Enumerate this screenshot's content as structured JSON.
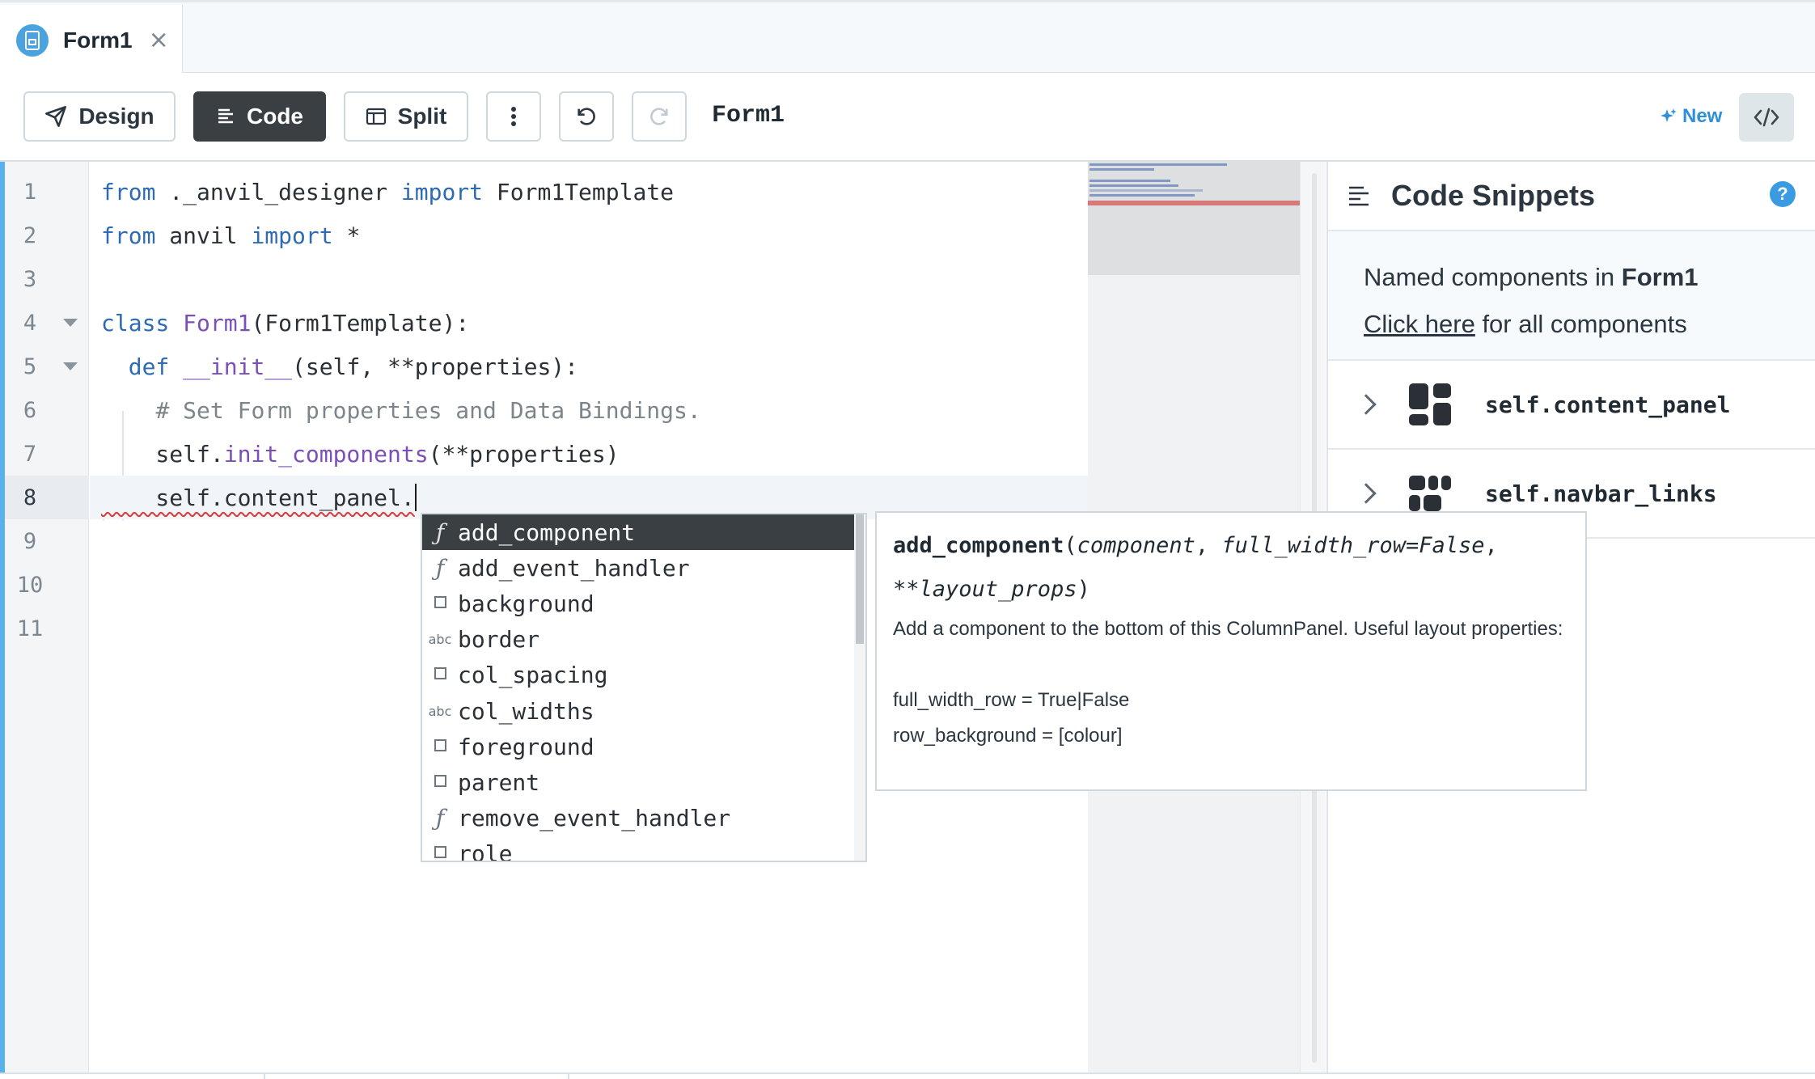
{
  "tab": {
    "label": "Form1",
    "close": "×"
  },
  "toolbar": {
    "design_label": "Design",
    "code_label": "Code",
    "split_label": "Split",
    "form_title": "Form1",
    "new_label": "New"
  },
  "editor": {
    "line_numbers": [
      "1",
      "2",
      "3",
      "4",
      "5",
      "6",
      "7",
      "8",
      "9",
      "10",
      "11"
    ],
    "current_line": 8,
    "lines": [
      [
        {
          "t": "from",
          "c": "kw"
        },
        {
          "t": " ._anvil_designer ",
          "c": "plain"
        },
        {
          "t": "import",
          "c": "kw"
        },
        {
          "t": " Form1Template",
          "c": "plain"
        }
      ],
      [
        {
          "t": "from",
          "c": "kw"
        },
        {
          "t": " anvil ",
          "c": "plain"
        },
        {
          "t": "import",
          "c": "kw"
        },
        {
          "t": " *",
          "c": "plain"
        }
      ],
      [],
      [
        {
          "t": "class",
          "c": "kw"
        },
        {
          "t": " ",
          "c": "plain"
        },
        {
          "t": "Form1",
          "c": "fn"
        },
        {
          "t": "(Form1Template):",
          "c": "plain"
        }
      ],
      [
        {
          "t": "  ",
          "c": "plain"
        },
        {
          "t": "def",
          "c": "kw"
        },
        {
          "t": " ",
          "c": "plain"
        },
        {
          "t": "__init__",
          "c": "fn"
        },
        {
          "t": "(self, **properties):",
          "c": "plain"
        }
      ],
      [
        {
          "t": "    ",
          "c": "plain"
        },
        {
          "t": "# Set Form properties and Data Bindings.",
          "c": "cm"
        }
      ],
      [
        {
          "t": "    self.",
          "c": "plain"
        },
        {
          "t": "init_components",
          "c": "fn"
        },
        {
          "t": "(**properties)",
          "c": "plain"
        }
      ],
      [
        {
          "t": "    self.content_panel.",
          "c": "plain"
        }
      ],
      [],
      [],
      []
    ]
  },
  "snippets": {
    "title": "Code Snippets",
    "help": "?",
    "named_prefix": "Named components in ",
    "form_name": "Form1",
    "click_here": "Click here",
    "all_components": " for all components",
    "components": [
      "self.content_panel",
      "self.navbar_links"
    ]
  },
  "autocomplete": {
    "items": [
      {
        "kind": "fn",
        "name": "add_component"
      },
      {
        "kind": "fn",
        "name": "add_event_handler"
      },
      {
        "kind": "prop",
        "name": "background"
      },
      {
        "kind": "str",
        "name": "border"
      },
      {
        "kind": "prop",
        "name": "col_spacing"
      },
      {
        "kind": "str",
        "name": "col_widths"
      },
      {
        "kind": "prop",
        "name": "foreground"
      },
      {
        "kind": "prop",
        "name": "parent"
      },
      {
        "kind": "fn",
        "name": "remove_event_handler"
      },
      {
        "kind": "prop",
        "name": "role"
      }
    ],
    "kind_labels": {
      "fn": "ƒ",
      "str": "abc",
      "prop": ""
    }
  },
  "doc": {
    "fn_name": "add_component",
    "open_paren": "(",
    "arg1": "component",
    "sep": ", ",
    "arg2": "full_width_row=False",
    "comma": ",",
    "arg3": "**layout_props",
    "close_paren": ")",
    "body": "Add a component to the bottom of this ColumnPanel. Useful layout properties:\n\nfull_width_row = True|False\nrow_background = [colour]"
  }
}
